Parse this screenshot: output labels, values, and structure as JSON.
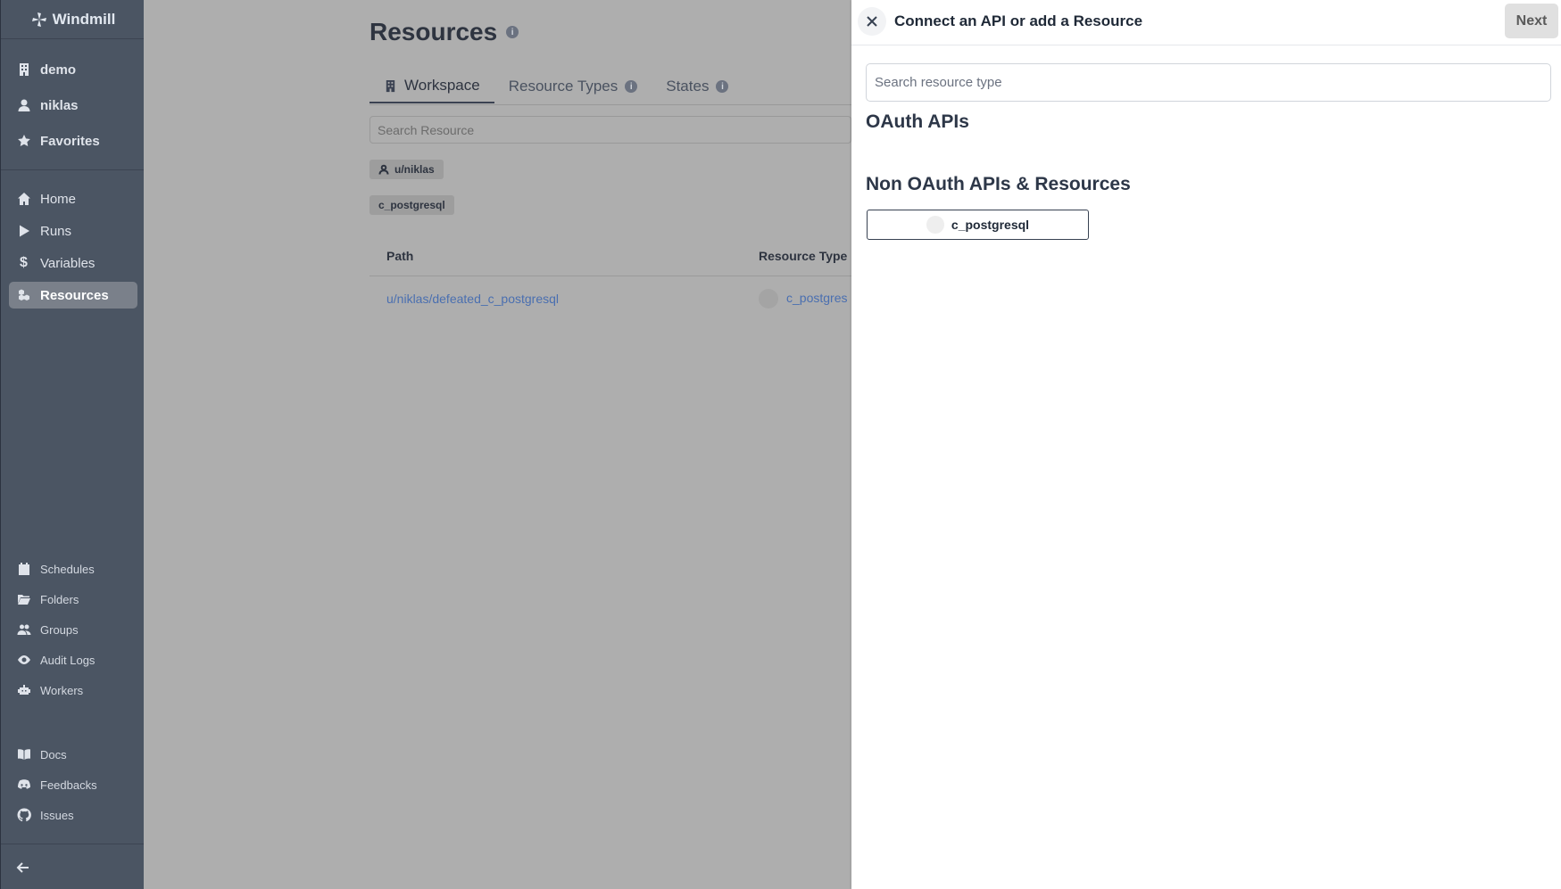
{
  "app": {
    "name": "Windmill"
  },
  "sidebar": {
    "top_items": [
      {
        "label": "demo",
        "icon": "building-icon"
      },
      {
        "label": "niklas",
        "icon": "user-icon"
      },
      {
        "label": "Favorites",
        "icon": "star-icon"
      }
    ],
    "main_items": [
      {
        "label": "Home",
        "icon": "home-icon"
      },
      {
        "label": "Runs",
        "icon": "play-icon"
      },
      {
        "label": "Variables",
        "icon": "dollar-icon"
      },
      {
        "label": "Resources",
        "icon": "boxes-icon",
        "active": true
      }
    ],
    "secondary_items": [
      {
        "label": "Schedules",
        "icon": "calendar-icon"
      },
      {
        "label": "Folders",
        "icon": "folder-open-icon"
      },
      {
        "label": "Groups",
        "icon": "users-icon"
      },
      {
        "label": "Audit Logs",
        "icon": "eye-icon"
      },
      {
        "label": "Workers",
        "icon": "bot-icon"
      }
    ],
    "help_items": [
      {
        "label": "Docs",
        "icon": "book-icon"
      },
      {
        "label": "Feedbacks",
        "icon": "discord-icon"
      },
      {
        "label": "Issues",
        "icon": "github-icon"
      }
    ]
  },
  "page": {
    "title": "Resources",
    "tabs": [
      {
        "label": "Workspace",
        "active": true
      },
      {
        "label": "Resource Types"
      },
      {
        "label": "States"
      }
    ],
    "search_placeholder": "Search Resource",
    "filters": [
      "u/niklas",
      "c_postgresql"
    ],
    "table": {
      "columns": [
        "Path",
        "Resource Type"
      ],
      "rows": [
        {
          "path": "u/niklas/defeated_c_postgresql",
          "resource_type": "c_postgres"
        }
      ]
    }
  },
  "drawer": {
    "title": "Connect an API or add a Resource",
    "next_label": "Next",
    "search_placeholder": "Search resource type",
    "oauth_heading": "OAuth APIs",
    "non_oauth_heading": "Non OAuth APIs & Resources",
    "resource_types": [
      "c_postgresql"
    ]
  },
  "colors": {
    "sidebar_bg": "#4b5563",
    "overlay_bg": "#aeaeae",
    "link": "#4a6fb0"
  }
}
